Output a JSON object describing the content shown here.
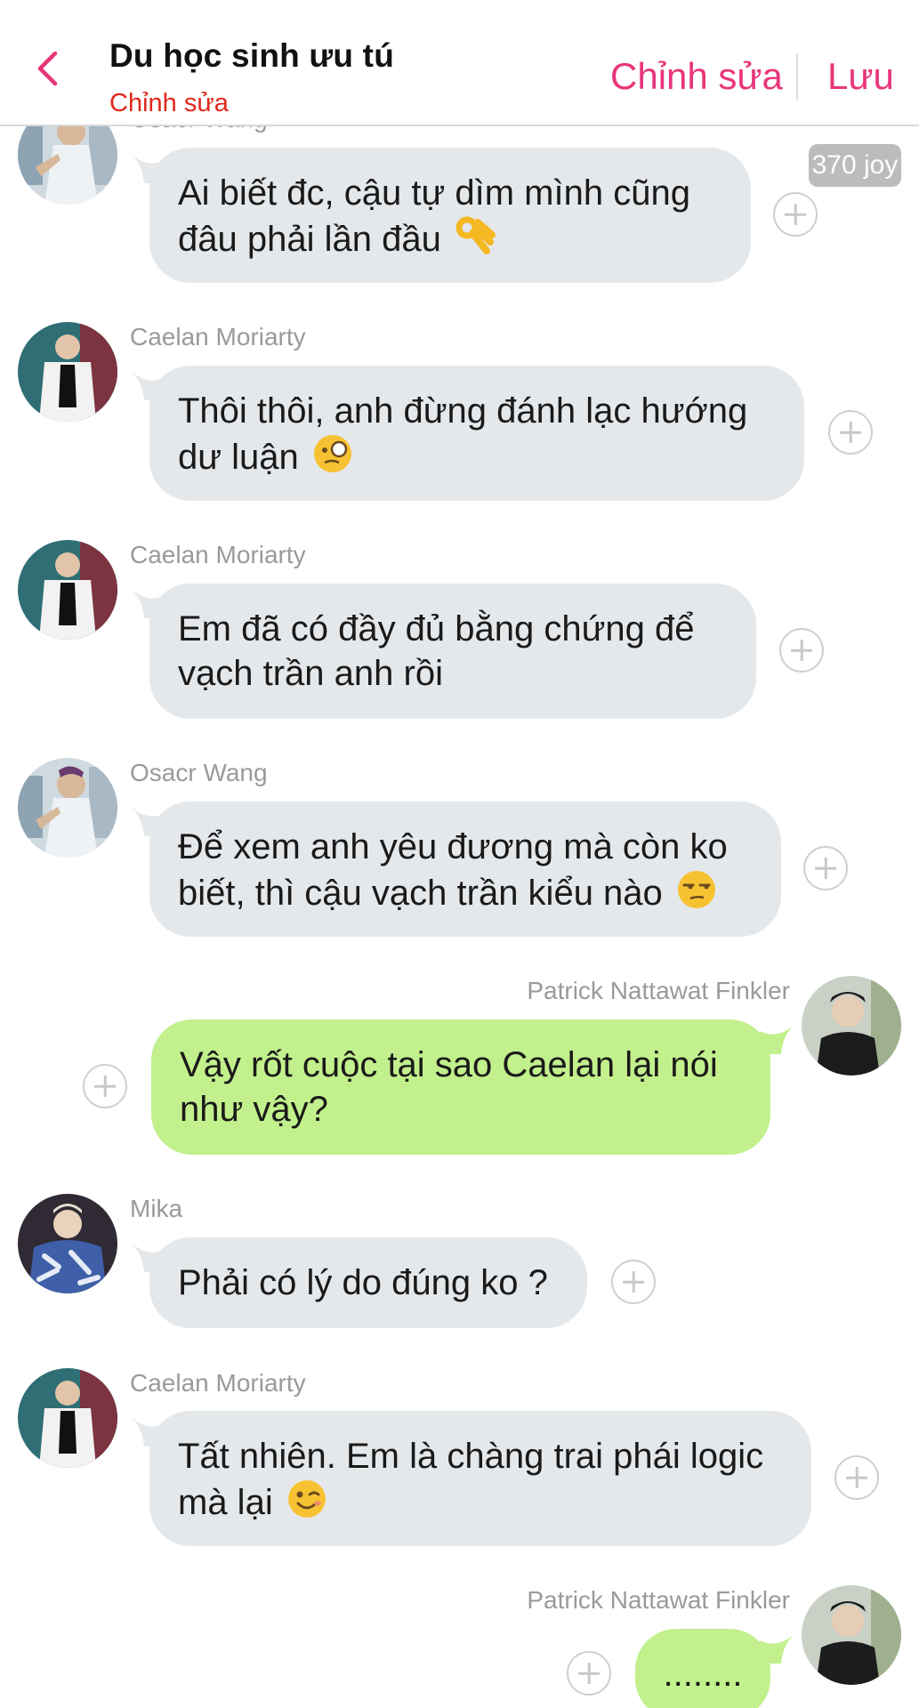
{
  "header": {
    "title": "Du học sinh ưu tú",
    "subtitle": "Chỉnh sửa",
    "edit_label": "Chỉnh sửa",
    "save_label": "Lưu",
    "accent_color": "#e8367a",
    "subtitle_color": "#e0281b",
    "back_icon": "chevron-left-icon"
  },
  "badge": {
    "text": "370 joy"
  },
  "messages": [
    {
      "sender": "Osacr Wang",
      "text": "Ai biết đc, cậu tự dìm mình cũng đâu phải lần đầu",
      "emoji": "ok-hand",
      "direction": "in"
    },
    {
      "sender": "Caelan Moriarty",
      "text": "Thôi thôi, anh đừng đánh lạc hướng dư luận",
      "emoji": "monocle-face",
      "direction": "in"
    },
    {
      "sender": "Caelan Moriarty",
      "text": "Em đã có đầy đủ bằng chứng để vạch trần anh rồi",
      "emoji": "",
      "direction": "in"
    },
    {
      "sender": "Osacr Wang",
      "text": "Để xem anh yêu đương mà còn ko biết, thì cậu vạch trần kiểu nào",
      "emoji": "unamused-face",
      "direction": "in"
    },
    {
      "sender": "Patrick Nattawat Finkler",
      "text": "Vậy rốt cuộc tại sao Caelan lại nói như vậy?",
      "emoji": "",
      "direction": "out"
    },
    {
      "sender": "Mika",
      "text": "Phải có lý do đúng ko ?",
      "emoji": "",
      "direction": "in"
    },
    {
      "sender": "Caelan Moriarty",
      "text": "Tất nhiên. Em là chàng trai phái logic mà lại",
      "emoji": "winking-face",
      "direction": "in"
    },
    {
      "sender": "Patrick Nattawat Finkler",
      "text": "........",
      "emoji": "",
      "direction": "out"
    }
  ],
  "colors": {
    "incoming_bubble": "#e5e8eb",
    "outgoing_bubble": "#c2f08c",
    "sender_name": "#9a9a9a"
  }
}
